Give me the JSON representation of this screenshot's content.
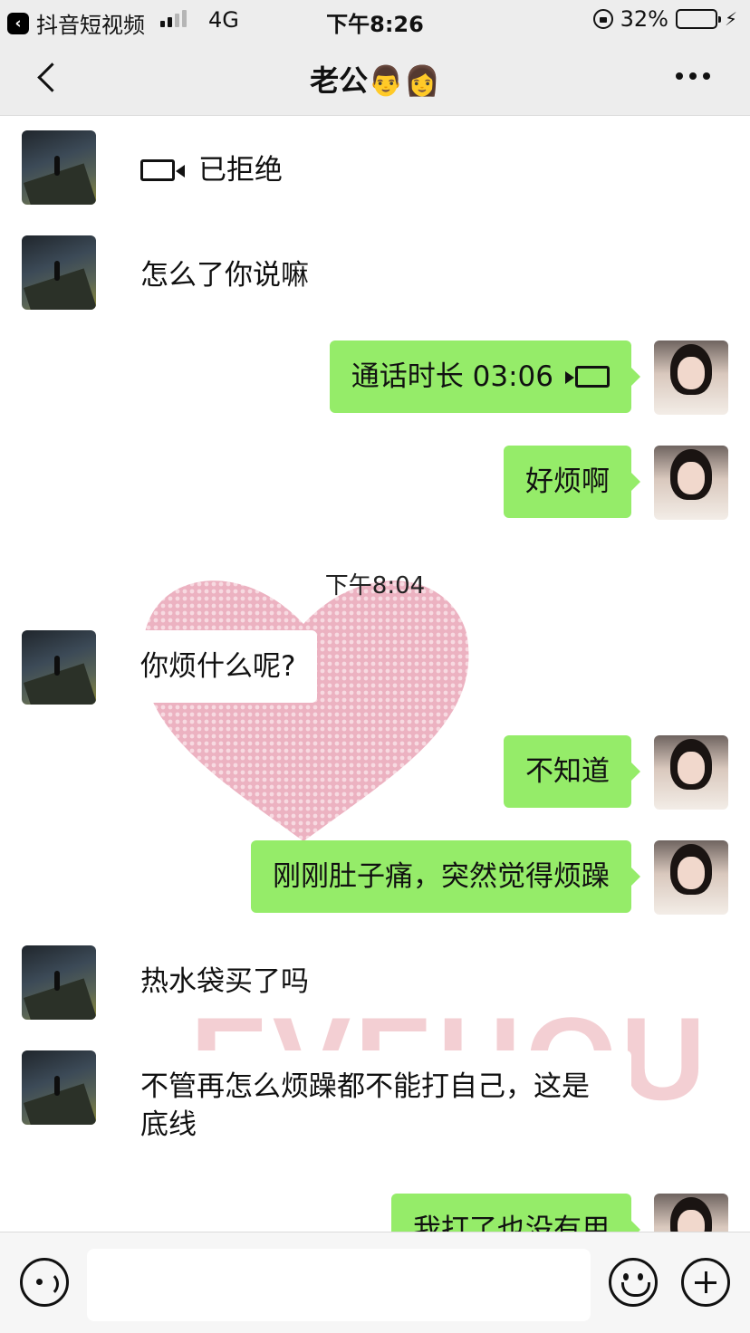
{
  "status_bar": {
    "back_app": "抖音短视频",
    "network": "4G",
    "time": "下午8:26",
    "battery": "32%",
    "battery_level": 0.32
  },
  "nav": {
    "title": "老公👨👩"
  },
  "messages": [
    {
      "from": "contact",
      "kind": "video-call",
      "text": "已拒绝"
    },
    {
      "from": "contact",
      "kind": "text",
      "text": "怎么了你说嘛"
    },
    {
      "from": "me",
      "kind": "video-call",
      "text": "通话时长 03:06"
    },
    {
      "from": "me",
      "kind": "text",
      "text": "好烦啊"
    },
    {
      "from": "contact",
      "kind": "text",
      "text": "你烦什么呢?"
    },
    {
      "from": "me",
      "kind": "text",
      "text": "不知道"
    },
    {
      "from": "me",
      "kind": "text",
      "text": "刚刚肚子痛，突然觉得烦躁"
    },
    {
      "from": "contact",
      "kind": "text",
      "text": "热水袋买了吗"
    },
    {
      "from": "contact",
      "kind": "text",
      "text": "不管再怎么烦躁都不能打自己，这是底线"
    },
    {
      "from": "me",
      "kind": "text",
      "text": "我打了也没有用"
    }
  ],
  "timestamp": "下午8:04",
  "wallpaper_text": "EVEHOU",
  "colors": {
    "outgoing_bubble": "#95ec69",
    "incoming_bubble": "#ffffff",
    "bar_background": "#ededed"
  }
}
